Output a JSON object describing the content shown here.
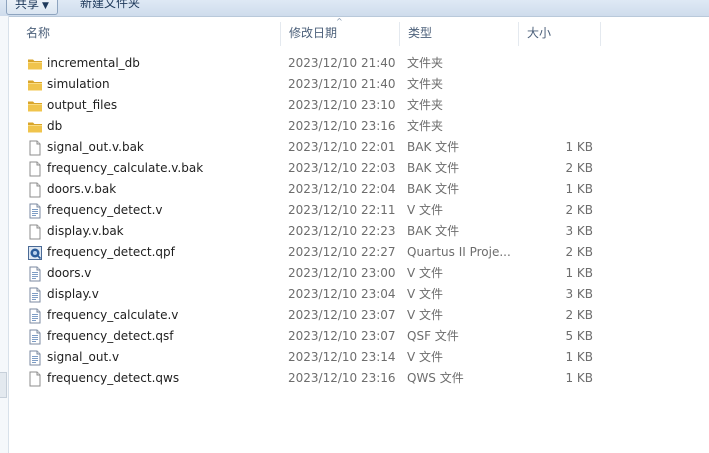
{
  "toolbar": {
    "share_label": "共享",
    "share_caret": "▼",
    "new_folder_label": "新建文件夹"
  },
  "columns": {
    "name": "名称",
    "date": "修改日期",
    "type": "类型",
    "size": "大小",
    "sort_indicator": "^"
  },
  "files": [
    {
      "name": "incremental_db",
      "date": "2023/12/10 21:40",
      "type": "文件夹",
      "size": "",
      "icon": "folder-icon"
    },
    {
      "name": "simulation",
      "date": "2023/12/10 21:40",
      "type": "文件夹",
      "size": "",
      "icon": "folder-icon"
    },
    {
      "name": "output_files",
      "date": "2023/12/10 23:10",
      "type": "文件夹",
      "size": "",
      "icon": "folder-icon"
    },
    {
      "name": "db",
      "date": "2023/12/10 23:16",
      "type": "文件夹",
      "size": "",
      "icon": "folder-icon"
    },
    {
      "name": "signal_out.v.bak",
      "date": "2023/12/10 22:01",
      "type": "BAK 文件",
      "size": "1 KB",
      "icon": "blank-file-icon"
    },
    {
      "name": "frequency_calculate.v.bak",
      "date": "2023/12/10 22:03",
      "type": "BAK 文件",
      "size": "2 KB",
      "icon": "blank-file-icon"
    },
    {
      "name": "doors.v.bak",
      "date": "2023/12/10 22:04",
      "type": "BAK 文件",
      "size": "1 KB",
      "icon": "blank-file-icon"
    },
    {
      "name": "frequency_detect.v",
      "date": "2023/12/10 22:11",
      "type": "V 文件",
      "size": "2 KB",
      "icon": "text-file-icon"
    },
    {
      "name": "display.v.bak",
      "date": "2023/12/10 22:23",
      "type": "BAK 文件",
      "size": "3 KB",
      "icon": "blank-file-icon"
    },
    {
      "name": "frequency_detect.qpf",
      "date": "2023/12/10 22:27",
      "type": "Quartus II Proje...",
      "size": "2 KB",
      "icon": "quartus-project-icon"
    },
    {
      "name": "doors.v",
      "date": "2023/12/10 23:00",
      "type": "V 文件",
      "size": "1 KB",
      "icon": "text-file-icon"
    },
    {
      "name": "display.v",
      "date": "2023/12/10 23:04",
      "type": "V 文件",
      "size": "3 KB",
      "icon": "text-file-icon"
    },
    {
      "name": "frequency_calculate.v",
      "date": "2023/12/10 23:07",
      "type": "V 文件",
      "size": "2 KB",
      "icon": "text-file-icon"
    },
    {
      "name": "frequency_detect.qsf",
      "date": "2023/12/10 23:07",
      "type": "QSF 文件",
      "size": "5 KB",
      "icon": "text-file-icon"
    },
    {
      "name": "signal_out.v",
      "date": "2023/12/10 23:14",
      "type": "V 文件",
      "size": "1 KB",
      "icon": "text-file-icon"
    },
    {
      "name": "frequency_detect.qws",
      "date": "2023/12/10 23:16",
      "type": "QWS 文件",
      "size": "1 KB",
      "icon": "blank-file-icon"
    }
  ],
  "colors": {
    "folder": "#f0c44c",
    "folder_dark": "#d9a52a",
    "header_text": "#4c607a",
    "meta_text": "#6d6d6d"
  }
}
